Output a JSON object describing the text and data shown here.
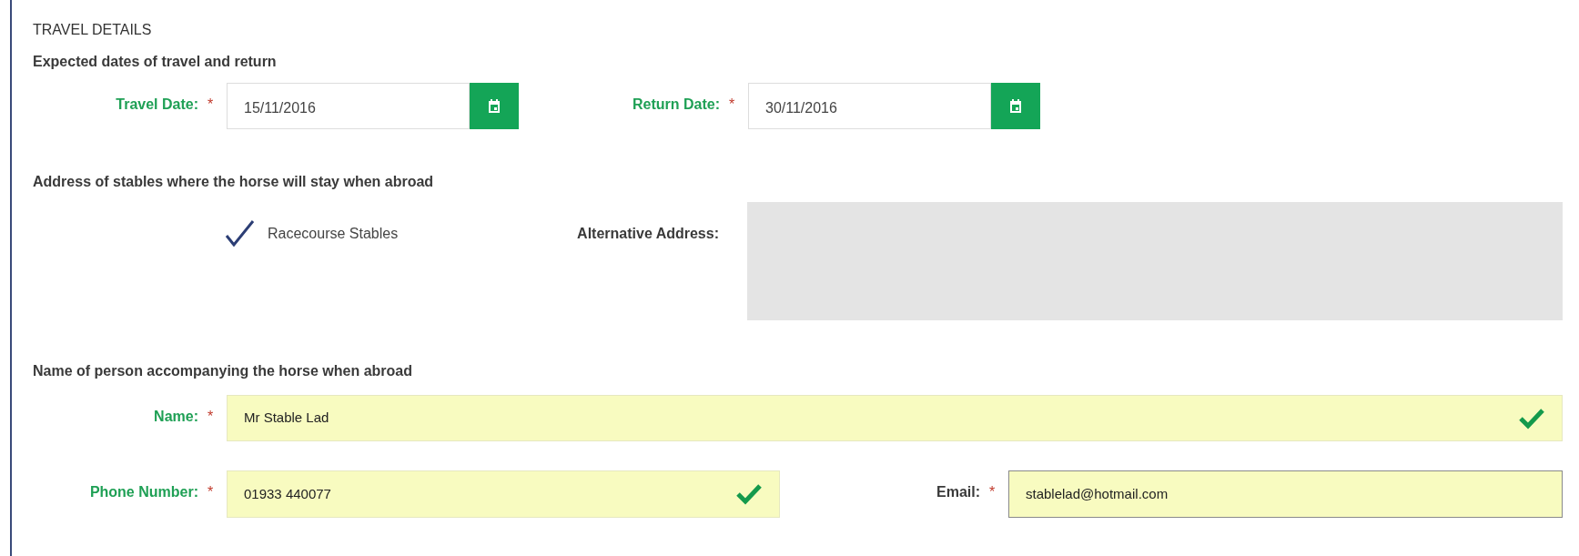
{
  "section_title": "TRAVEL DETAILS",
  "dates": {
    "heading": "Expected dates of travel and return",
    "fields": [
      {
        "label": "Travel Date:",
        "required_mark": "*",
        "value": "15/11/2016"
      },
      {
        "label": "Return Date:",
        "required_mark": "*",
        "value": "30/11/2016"
      }
    ]
  },
  "stables": {
    "heading": "Address of stables where the horse will stay when abroad",
    "option": {
      "label": "Racecourse Stables",
      "checked": true
    },
    "alternative_label": "Alternative Address:"
  },
  "person": {
    "heading": "Name of person accompanying the horse when abroad",
    "fields": [
      {
        "label": "Name:",
        "required_mark": "*",
        "value": "Mr Stable Lad",
        "valid": true,
        "focused": false
      },
      {
        "label": "Phone Number:",
        "required_mark": "*",
        "value": "01933 440077",
        "valid": true,
        "focused": false
      },
      {
        "label": "Email:",
        "required_mark": "*",
        "value": "stablelad@hotmail.com",
        "valid": false,
        "focused": true
      }
    ]
  }
}
